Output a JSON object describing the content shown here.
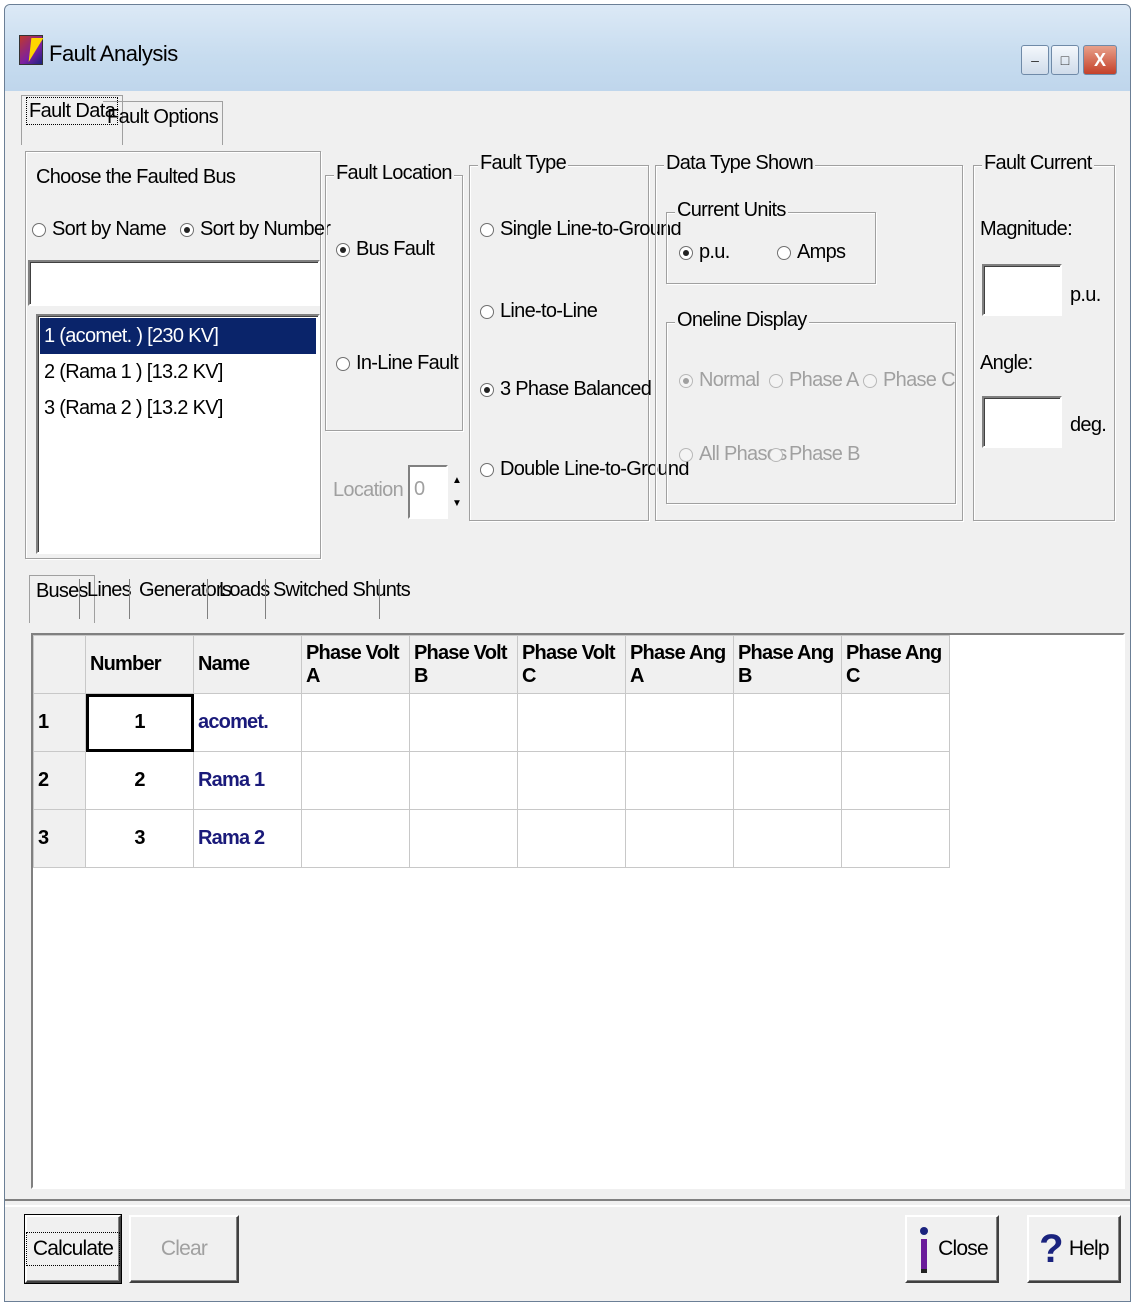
{
  "window": {
    "title": "Fault Analysis",
    "minimize": "–",
    "maximize": "□",
    "close": "X"
  },
  "main_tabs": [
    {
      "label": "Fault Data"
    },
    {
      "label": "Fault Options"
    }
  ],
  "bus_chooser": {
    "title": "Choose the Faulted Bus",
    "sort_by_name": "Sort by Name",
    "sort_by_number": "Sort by Number",
    "search_value": "",
    "items": [
      "1 (acomet. ) [230 KV]",
      "2 (Rama 1 ) [13.2 KV]",
      "3 (Rama 2 ) [13.2 KV]"
    ]
  },
  "fault_location": {
    "title": "Fault Location",
    "bus_fault": "Bus Fault",
    "inline_fault": "In-Line Fault",
    "location_label": "Location %",
    "location_value": "0"
  },
  "fault_type": {
    "title": "Fault Type",
    "options": [
      "Single Line-to-Ground",
      "Line-to-Line",
      "3 Phase Balanced",
      "Double Line-to-Ground"
    ]
  },
  "data_type": {
    "title": "Data Type Shown",
    "current_units_title": "Current Units",
    "pu": "p.u.",
    "amps": "Amps",
    "oneline_title": "Oneline Display",
    "normal": "Normal",
    "phase_a": "Phase A",
    "phase_c": "Phase C",
    "all_phases": "All Phases",
    "phase_b": "Phase B"
  },
  "fault_current": {
    "title": "Fault Current",
    "magnitude_label": "Magnitude:",
    "magnitude_value": "",
    "magnitude_unit": "p.u.",
    "angle_label": "Angle:",
    "angle_value": "",
    "angle_unit": "deg."
  },
  "sub_tabs": [
    "Buses",
    "Lines",
    "Generators",
    "Loads",
    "Switched Shunts"
  ],
  "grid": {
    "columns": [
      "Number",
      "Name",
      "Phase Volt A",
      "Phase Volt B",
      "Phase Volt C",
      "Phase Ang A",
      "Phase Ang B",
      "Phase Ang C"
    ],
    "rows": [
      {
        "row": "1",
        "number": "1",
        "name": "acomet."
      },
      {
        "row": "2",
        "number": "2",
        "name": "Rama 1"
      },
      {
        "row": "3",
        "number": "3",
        "name": "Rama 2"
      }
    ]
  },
  "buttons": {
    "calculate": "Calculate",
    "clear": "Clear",
    "close": "Close",
    "help": "Help"
  }
}
